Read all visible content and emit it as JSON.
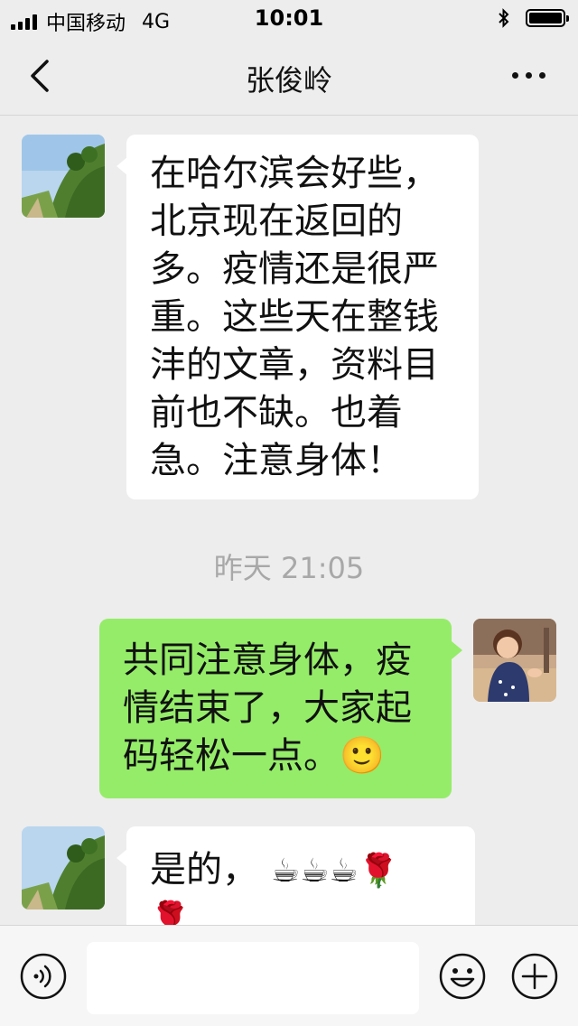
{
  "status_bar": {
    "carrier": "中国移动",
    "network": "4G",
    "time": "10:01",
    "signal_bars": 4
  },
  "header": {
    "title": "张俊岭"
  },
  "messages": [
    {
      "side": "left",
      "lines": [
        "在哈尔滨会好些，",
        "北京现在返回的",
        "多。疫情还是很严",
        "重。这些天在整钱",
        "沣的文章，资料目",
        "前也不缺。也着",
        "急。注意身体！"
      ]
    },
    {
      "side": "right",
      "lines": [
        "共同注意身体，疫",
        "情结束了，大家起",
        "码轻松一点。"
      ],
      "emoji": "🙂"
    },
    {
      "side": "left",
      "lines": [
        "是的，"
      ],
      "emoji_line": "☕☕☕🌹",
      "emoji_wrap": "🌹"
    }
  ],
  "timestamp": "昨天 21:05",
  "input": {
    "placeholder": ""
  },
  "icons": {
    "voice": "voice-icon",
    "emoji": "emoji-icon",
    "plus": "plus-icon",
    "back": "back-chevron-icon",
    "more": "more-icon"
  },
  "colors": {
    "green_bubble": "#95ec69",
    "white_bubble": "#ffffff",
    "background": "#ededed"
  }
}
